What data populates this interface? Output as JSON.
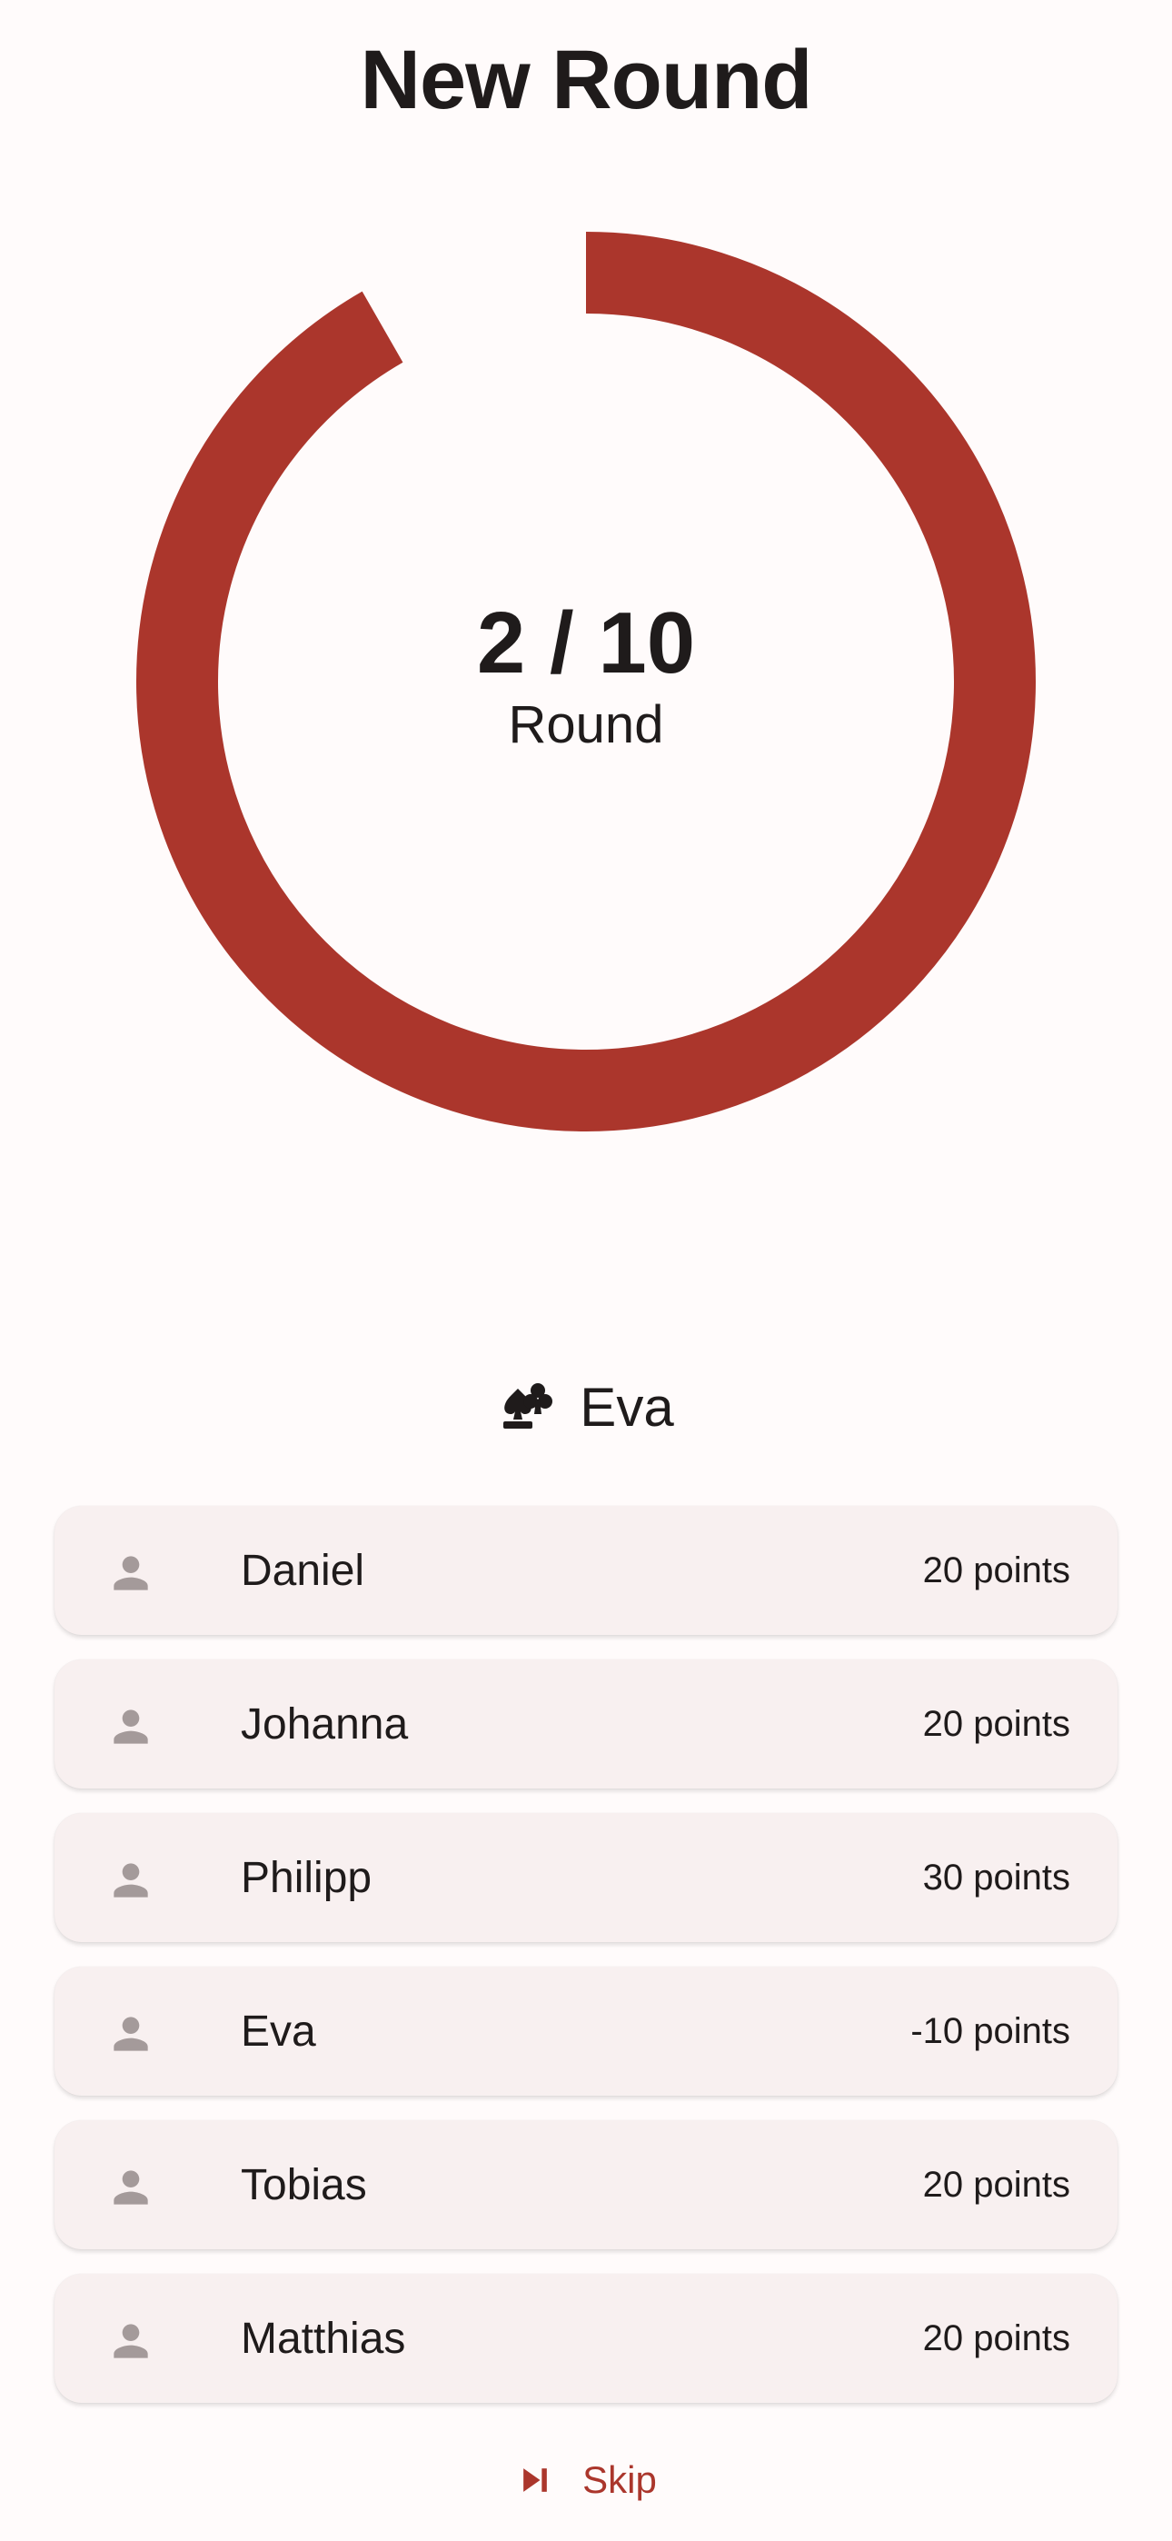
{
  "header": {
    "title": "New Round"
  },
  "round": {
    "current": 2,
    "total": 10,
    "count_label": "2 / 10",
    "label": "Round",
    "arc_color": "#ab362c"
  },
  "dealer": {
    "icon": "cards-clubs-icon",
    "name": "Eva"
  },
  "players": [
    {
      "name": "Daniel",
      "points": "20 points",
      "icon": "person-icon"
    },
    {
      "name": "Johanna",
      "points": "20 points",
      "icon": "person-icon"
    },
    {
      "name": "Philipp",
      "points": "30 points",
      "icon": "person-icon"
    },
    {
      "name": "Eva",
      "points": "-10 points",
      "icon": "person-icon"
    },
    {
      "name": "Tobias",
      "points": "20 points",
      "icon": "person-icon"
    },
    {
      "name": "Matthias",
      "points": "20 points",
      "icon": "person-icon"
    }
  ],
  "skip": {
    "label": "Skip",
    "icon": "skip-next-icon",
    "color": "#ab362c"
  }
}
